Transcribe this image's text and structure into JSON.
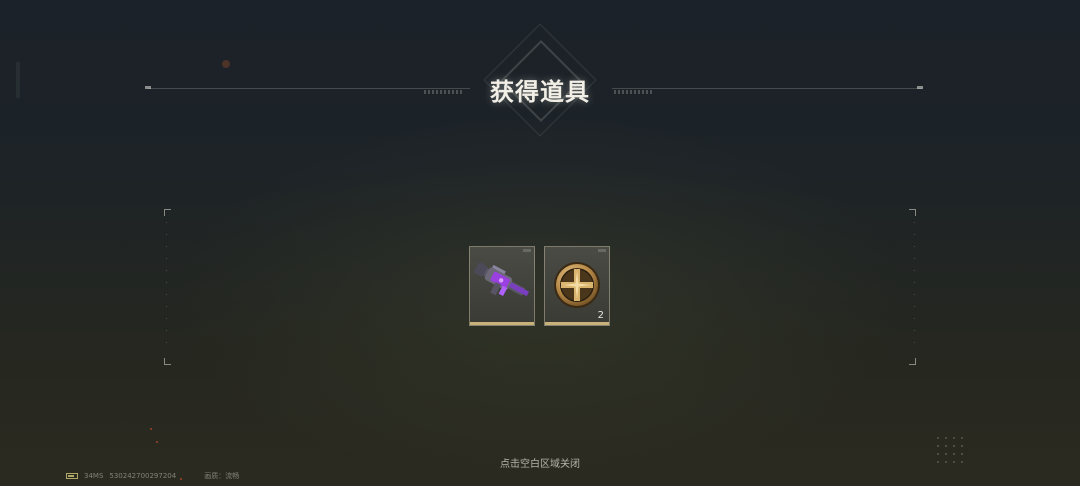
{
  "dialog": {
    "title": "获得道具",
    "close_hint": "点击空白区域关闭"
  },
  "items": [
    {
      "icon": "purple-rifle-icon",
      "quantity": ""
    },
    {
      "icon": "gold-cross-medal-icon",
      "quantity": "2"
    }
  ],
  "status_bar": {
    "latency": "34MS",
    "player_id": "530242700297204",
    "quality": "画质：流畅"
  },
  "colors": {
    "accent_gold": "#c9b27a",
    "title_text": "#f2efe6",
    "rifle_purple": "#9a3fe0"
  }
}
